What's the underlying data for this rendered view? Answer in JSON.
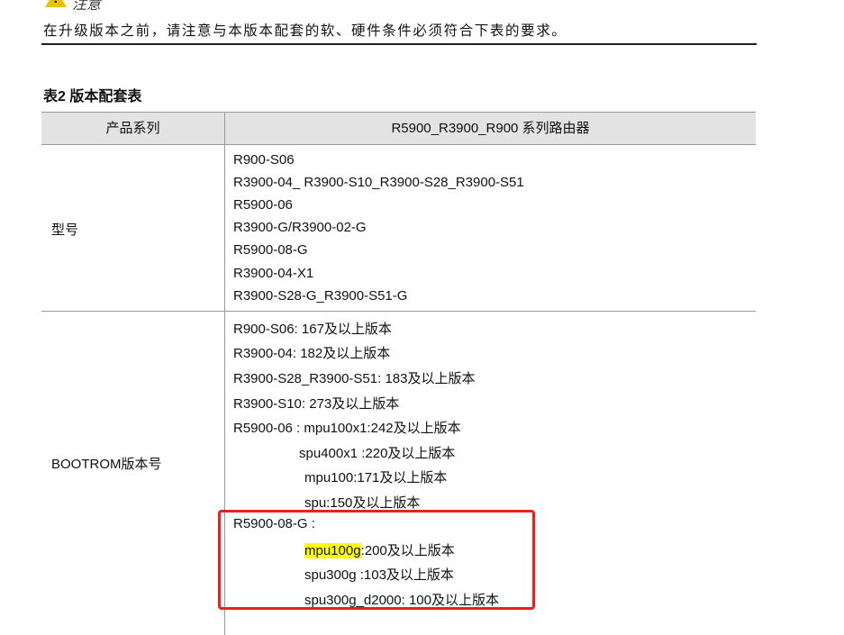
{
  "caution": {
    "label": "注意",
    "text": "在升级版本之前，请注意与本版本配套的软、硬件条件必须符合下表的要求。"
  },
  "table": {
    "caption": "表2 版本配套表",
    "headers": [
      "产品系列",
      "R5900_R3900_R900 系列路由器"
    ],
    "model_row": {
      "label": "型号",
      "lines": [
        "R900-S06",
        "R3900-04_ R3900-S10_R3900-S28_R3900-S51",
        "R5900-06",
        "R3900-G/R3900-02-G",
        "R5900-08-G",
        "R3900-04-X1",
        "R3900-S28-G_R3900-S51-G"
      ]
    },
    "bootrom_row": {
      "label": "BOOTROM版本号",
      "lines": [
        "R900-S06: 167及以上版本",
        "R3900-04: 182及以上版本",
        "R3900-S28_R3900-S51: 183及以上版本",
        "R3900-S10: 273及以上版本",
        "R5900-06 : mpu100x1:242及以上版本",
        "spu400x1 :220及以上版本",
        "mpu100:171及以上版本",
        "spu:150及以上版本",
        "R5900-08-G :"
      ],
      "highlighted": {
        "prefix": "mpu100g",
        "rest": ":200及以上版本"
      },
      "tail_lines": [
        "spu300g :103及以上版本",
        "spu300g_d2000: 100及以上版本"
      ]
    }
  },
  "colors": {
    "header_bg": "#e3e3e3",
    "highlight": "#ffff00",
    "annotation_box": "#e8201f",
    "warning_icon": "#e6c200"
  }
}
